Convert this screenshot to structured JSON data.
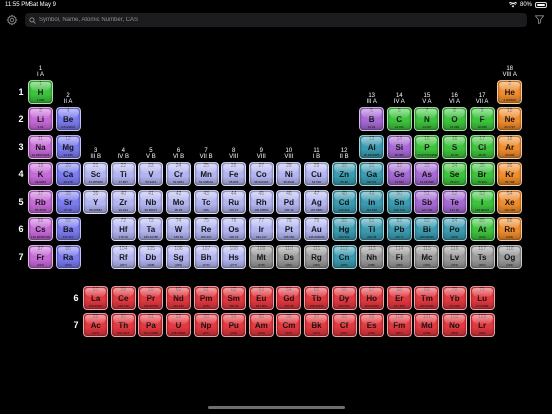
{
  "status": {
    "time": "11:55 PM",
    "date": "Sat May 9",
    "battery": "80%"
  },
  "search": {
    "placeholder": "Symbol, Name, Atomic Number, CAS"
  },
  "periods": [
    "1",
    "2",
    "3",
    "4",
    "5",
    "6",
    "7"
  ],
  "fperiods": [
    "6",
    "7"
  ],
  "groups": [
    {
      "col": 1,
      "n": "1",
      "r": "I A",
      "row": 1
    },
    {
      "col": 2,
      "n": "2",
      "r": "II A",
      "row": 2
    },
    {
      "col": 3,
      "n": "3",
      "r": "III B",
      "row": 4
    },
    {
      "col": 4,
      "n": "4",
      "r": "IV B",
      "row": 4
    },
    {
      "col": 5,
      "n": "5",
      "r": "V B",
      "row": 4
    },
    {
      "col": 6,
      "n": "6",
      "r": "VI B",
      "row": 4
    },
    {
      "col": 7,
      "n": "7",
      "r": "VII B",
      "row": 4
    },
    {
      "col": 8,
      "n": "8",
      "r": "VIII",
      "row": 4
    },
    {
      "col": 9,
      "n": "9",
      "r": "VIII",
      "row": 4
    },
    {
      "col": 10,
      "n": "10",
      "r": "VIII",
      "row": 4
    },
    {
      "col": 11,
      "n": "11",
      "r": "I B",
      "row": 4
    },
    {
      "col": 12,
      "n": "12",
      "r": "II B",
      "row": 4
    },
    {
      "col": 13,
      "n": "13",
      "r": "III A",
      "row": 2
    },
    {
      "col": 14,
      "n": "14",
      "r": "IV A",
      "row": 2
    },
    {
      "col": 15,
      "n": "15",
      "r": "V A",
      "row": 2
    },
    {
      "col": 16,
      "n": "16",
      "r": "VI A",
      "row": 2
    },
    {
      "col": 17,
      "n": "17",
      "r": "VII A",
      "row": 2
    },
    {
      "col": 18,
      "n": "18",
      "r": "VIII A",
      "row": 1
    }
  ],
  "colors": {
    "nonmetal": "#3ec33e",
    "alkali": "#c66ad8",
    "alkaline": "#7b7bf0",
    "transition": "#b3b5f0",
    "post": "#3b9bb0",
    "metalloid": "#a56ad3",
    "halogen": "#3ec33e",
    "noble": "#ef8c2d",
    "unknown": "#9a9a9a",
    "lanthanide": "#e2383f",
    "actinide": "#e2383f"
  },
  "elements": [
    {
      "n": 1,
      "s": "H",
      "m": "1.008",
      "p": 1,
      "g": 1,
      "c": "nonmetal"
    },
    {
      "n": 2,
      "s": "He",
      "m": "4.002602",
      "p": 1,
      "g": 18,
      "c": "noble"
    },
    {
      "n": 3,
      "s": "Li",
      "m": "6.94",
      "p": 2,
      "g": 1,
      "c": "alkali"
    },
    {
      "n": 4,
      "s": "Be",
      "m": "9.0121831",
      "p": 2,
      "g": 2,
      "c": "alkaline"
    },
    {
      "n": 5,
      "s": "B",
      "m": "10.81",
      "p": 2,
      "g": 13,
      "c": "metalloid"
    },
    {
      "n": 6,
      "s": "C",
      "m": "12.011",
      "p": 2,
      "g": 14,
      "c": "nonmetal"
    },
    {
      "n": 7,
      "s": "N",
      "m": "14.007",
      "p": 2,
      "g": 15,
      "c": "nonmetal"
    },
    {
      "n": 8,
      "s": "O",
      "m": "15.999",
      "p": 2,
      "g": 16,
      "c": "nonmetal"
    },
    {
      "n": 9,
      "s": "F",
      "m": "18.998",
      "p": 2,
      "g": 17,
      "c": "halogen"
    },
    {
      "n": 10,
      "s": "Ne",
      "m": "20.1797",
      "p": 2,
      "g": 18,
      "c": "noble"
    },
    {
      "n": 11,
      "s": "Na",
      "m": "22.98976928",
      "p": 3,
      "g": 1,
      "c": "alkali"
    },
    {
      "n": 12,
      "s": "Mg",
      "m": "24.305",
      "p": 3,
      "g": 2,
      "c": "alkaline"
    },
    {
      "n": 13,
      "s": "Al",
      "m": "26.9815385",
      "p": 3,
      "g": 13,
      "c": "post"
    },
    {
      "n": 14,
      "s": "Si",
      "m": "28.085",
      "p": 3,
      "g": 14,
      "c": "metalloid"
    },
    {
      "n": 15,
      "s": "P",
      "m": "30.973761998",
      "p": 3,
      "g": 15,
      "c": "nonmetal"
    },
    {
      "n": 16,
      "s": "S",
      "m": "32.06",
      "p": 3,
      "g": 16,
      "c": "nonmetal"
    },
    {
      "n": 17,
      "s": "Cl",
      "m": "35.45",
      "p": 3,
      "g": 17,
      "c": "halogen"
    },
    {
      "n": 18,
      "s": "Ar",
      "m": "39.948",
      "p": 3,
      "g": 18,
      "c": "noble"
    },
    {
      "n": 19,
      "s": "K",
      "m": "39.0983",
      "p": 4,
      "g": 1,
      "c": "alkali"
    },
    {
      "n": 20,
      "s": "Ca",
      "m": "40.078",
      "p": 4,
      "g": 2,
      "c": "alkaline"
    },
    {
      "n": 21,
      "s": "Sc",
      "m": "44.955908",
      "p": 4,
      "g": 3,
      "c": "transition"
    },
    {
      "n": 22,
      "s": "Ti",
      "m": "47.867",
      "p": 4,
      "g": 4,
      "c": "transition"
    },
    {
      "n": 23,
      "s": "V",
      "m": "50.9415",
      "p": 4,
      "g": 5,
      "c": "transition"
    },
    {
      "n": 24,
      "s": "Cr",
      "m": "51.9961",
      "p": 4,
      "g": 6,
      "c": "transition"
    },
    {
      "n": 25,
      "s": "Mn",
      "m": "54.938044",
      "p": 4,
      "g": 7,
      "c": "transition"
    },
    {
      "n": 26,
      "s": "Fe",
      "m": "55.845",
      "p": 4,
      "g": 8,
      "c": "transition"
    },
    {
      "n": 27,
      "s": "Co",
      "m": "58.933194",
      "p": 4,
      "g": 9,
      "c": "transition"
    },
    {
      "n": 28,
      "s": "Ni",
      "m": "58.6934",
      "p": 4,
      "g": 10,
      "c": "transition"
    },
    {
      "n": 29,
      "s": "Cu",
      "m": "63.546",
      "p": 4,
      "g": 11,
      "c": "transition"
    },
    {
      "n": 30,
      "s": "Zn",
      "m": "65.38",
      "p": 4,
      "g": 12,
      "c": "post"
    },
    {
      "n": 31,
      "s": "Ga",
      "m": "69.723",
      "p": 4,
      "g": 13,
      "c": "post"
    },
    {
      "n": 32,
      "s": "Ge",
      "m": "72.630",
      "p": 4,
      "g": 14,
      "c": "metalloid"
    },
    {
      "n": 33,
      "s": "As",
      "m": "74.921595",
      "p": 4,
      "g": 15,
      "c": "metalloid"
    },
    {
      "n": 34,
      "s": "Se",
      "m": "78.971",
      "p": 4,
      "g": 16,
      "c": "nonmetal"
    },
    {
      "n": 35,
      "s": "Br",
      "m": "79.904",
      "p": 4,
      "g": 17,
      "c": "halogen"
    },
    {
      "n": 36,
      "s": "Kr",
      "m": "83.798",
      "p": 4,
      "g": 18,
      "c": "noble"
    },
    {
      "n": 37,
      "s": "Rb",
      "m": "85.4678",
      "p": 5,
      "g": 1,
      "c": "alkali"
    },
    {
      "n": 38,
      "s": "Sr",
      "m": "87.62",
      "p": 5,
      "g": 2,
      "c": "alkaline"
    },
    {
      "n": 39,
      "s": "Y",
      "m": "88.90584",
      "p": 5,
      "g": 3,
      "c": "transition"
    },
    {
      "n": 40,
      "s": "Zr",
      "m": "91.224",
      "p": 5,
      "g": 4,
      "c": "transition"
    },
    {
      "n": 41,
      "s": "Nb",
      "m": "92.90637",
      "p": 5,
      "g": 5,
      "c": "transition"
    },
    {
      "n": 42,
      "s": "Mo",
      "m": "95.95",
      "p": 5,
      "g": 6,
      "c": "transition"
    },
    {
      "n": 43,
      "s": "Tc",
      "m": "(98)",
      "p": 5,
      "g": 7,
      "c": "transition"
    },
    {
      "n": 44,
      "s": "Ru",
      "m": "101.07",
      "p": 5,
      "g": 8,
      "c": "transition"
    },
    {
      "n": 45,
      "s": "Rh",
      "m": "102.90550",
      "p": 5,
      "g": 9,
      "c": "transition"
    },
    {
      "n": 46,
      "s": "Pd",
      "m": "106.42",
      "p": 5,
      "g": 10,
      "c": "transition"
    },
    {
      "n": 47,
      "s": "Ag",
      "m": "107.8682",
      "p": 5,
      "g": 11,
      "c": "transition"
    },
    {
      "n": 48,
      "s": "Cd",
      "m": "112.414",
      "p": 5,
      "g": 12,
      "c": "post"
    },
    {
      "n": 49,
      "s": "In",
      "m": "114.818",
      "p": 5,
      "g": 13,
      "c": "post"
    },
    {
      "n": 50,
      "s": "Sn",
      "m": "118.710",
      "p": 5,
      "g": 14,
      "c": "post"
    },
    {
      "n": 51,
      "s": "Sb",
      "m": "121.760",
      "p": 5,
      "g": 15,
      "c": "metalloid"
    },
    {
      "n": 52,
      "s": "Te",
      "m": "127.60",
      "p": 5,
      "g": 16,
      "c": "metalloid"
    },
    {
      "n": 53,
      "s": "I",
      "m": "126.90447",
      "p": 5,
      "g": 17,
      "c": "halogen"
    },
    {
      "n": 54,
      "s": "Xe",
      "m": "131.293",
      "p": 5,
      "g": 18,
      "c": "noble"
    },
    {
      "n": 55,
      "s": "Cs",
      "m": "132.90545196",
      "p": 6,
      "g": 1,
      "c": "alkali"
    },
    {
      "n": 56,
      "s": "Ba",
      "m": "137.327",
      "p": 6,
      "g": 2,
      "c": "alkaline"
    },
    {
      "n": 72,
      "s": "Hf",
      "m": "178.49",
      "p": 6,
      "g": 4,
      "c": "transition"
    },
    {
      "n": 73,
      "s": "Ta",
      "m": "180.94788",
      "p": 6,
      "g": 5,
      "c": "transition"
    },
    {
      "n": 74,
      "s": "W",
      "m": "183.84",
      "p": 6,
      "g": 6,
      "c": "transition"
    },
    {
      "n": 75,
      "s": "Re",
      "m": "186.207",
      "p": 6,
      "g": 7,
      "c": "transition"
    },
    {
      "n": 76,
      "s": "Os",
      "m": "190.23",
      "p": 6,
      "g": 8,
      "c": "transition"
    },
    {
      "n": 77,
      "s": "Ir",
      "m": "192.217",
      "p": 6,
      "g": 9,
      "c": "transition"
    },
    {
      "n": 78,
      "s": "Pt",
      "m": "195.084",
      "p": 6,
      "g": 10,
      "c": "transition"
    },
    {
      "n": 79,
      "s": "Au",
      "m": "196.966569",
      "p": 6,
      "g": 11,
      "c": "transition"
    },
    {
      "n": 80,
      "s": "Hg",
      "m": "200.592",
      "p": 6,
      "g": 12,
      "c": "post"
    },
    {
      "n": 81,
      "s": "Tl",
      "m": "204.38",
      "p": 6,
      "g": 13,
      "c": "post"
    },
    {
      "n": 82,
      "s": "Pb",
      "m": "207.2",
      "p": 6,
      "g": 14,
      "c": "post"
    },
    {
      "n": 83,
      "s": "Bi",
      "m": "208.98040",
      "p": 6,
      "g": 15,
      "c": "post"
    },
    {
      "n": 84,
      "s": "Po",
      "m": "(209)",
      "p": 6,
      "g": 16,
      "c": "post"
    },
    {
      "n": 85,
      "s": "At",
      "m": "(210)",
      "p": 6,
      "g": 17,
      "c": "halogen"
    },
    {
      "n": 86,
      "s": "Rn",
      "m": "(222)",
      "p": 6,
      "g": 18,
      "c": "noble"
    },
    {
      "n": 87,
      "s": "Fr",
      "m": "(223)",
      "p": 7,
      "g": 1,
      "c": "alkali"
    },
    {
      "n": 88,
      "s": "Ra",
      "m": "(226)",
      "p": 7,
      "g": 2,
      "c": "alkaline"
    },
    {
      "n": 104,
      "s": "Rf",
      "m": "(267)",
      "p": 7,
      "g": 4,
      "c": "transition"
    },
    {
      "n": 105,
      "s": "Db",
      "m": "(268)",
      "p": 7,
      "g": 5,
      "c": "transition"
    },
    {
      "n": 106,
      "s": "Sg",
      "m": "(269)",
      "p": 7,
      "g": 6,
      "c": "transition"
    },
    {
      "n": 107,
      "s": "Bh",
      "m": "(270)",
      "p": 7,
      "g": 7,
      "c": "transition"
    },
    {
      "n": 108,
      "s": "Hs",
      "m": "(277)",
      "p": 7,
      "g": 8,
      "c": "transition"
    },
    {
      "n": 109,
      "s": "Mt",
      "m": "(278)",
      "p": 7,
      "g": 9,
      "c": "unknown"
    },
    {
      "n": 110,
      "s": "Ds",
      "m": "(281)",
      "p": 7,
      "g": 10,
      "c": "unknown"
    },
    {
      "n": 111,
      "s": "Rg",
      "m": "(282)",
      "p": 7,
      "g": 11,
      "c": "unknown"
    },
    {
      "n": 112,
      "s": "Cn",
      "m": "(285)",
      "p": 7,
      "g": 12,
      "c": "post"
    },
    {
      "n": 113,
      "s": "Nh",
      "m": "(286)",
      "p": 7,
      "g": 13,
      "c": "unknown"
    },
    {
      "n": 114,
      "s": "Fl",
      "m": "(289)",
      "p": 7,
      "g": 14,
      "c": "unknown"
    },
    {
      "n": 115,
      "s": "Mc",
      "m": "(290)",
      "p": 7,
      "g": 15,
      "c": "unknown"
    },
    {
      "n": 116,
      "s": "Lv",
      "m": "(293)",
      "p": 7,
      "g": 16,
      "c": "unknown"
    },
    {
      "n": 117,
      "s": "Ts",
      "m": "(294)",
      "p": 7,
      "g": 17,
      "c": "unknown"
    },
    {
      "n": 118,
      "s": "Og",
      "m": "(294)",
      "p": 7,
      "g": 18,
      "c": "unknown"
    },
    {
      "n": 57,
      "s": "La",
      "m": "138.90547",
      "p": 9,
      "g": 3,
      "c": "lanthanide"
    },
    {
      "n": 58,
      "s": "Ce",
      "m": "140.116",
      "p": 9,
      "g": 4,
      "c": "lanthanide"
    },
    {
      "n": 59,
      "s": "Pr",
      "m": "140.90766",
      "p": 9,
      "g": 5,
      "c": "lanthanide"
    },
    {
      "n": 60,
      "s": "Nd",
      "m": "144.242",
      "p": 9,
      "g": 6,
      "c": "lanthanide"
    },
    {
      "n": 61,
      "s": "Pm",
      "m": "(145)",
      "p": 9,
      "g": 7,
      "c": "lanthanide"
    },
    {
      "n": 62,
      "s": "Sm",
      "m": "150.36",
      "p": 9,
      "g": 8,
      "c": "lanthanide"
    },
    {
      "n": 63,
      "s": "Eu",
      "m": "151.964",
      "p": 9,
      "g": 9,
      "c": "lanthanide"
    },
    {
      "n": 64,
      "s": "Gd",
      "m": "157.25",
      "p": 9,
      "g": 10,
      "c": "lanthanide"
    },
    {
      "n": 65,
      "s": "Tb",
      "m": "158.92535",
      "p": 9,
      "g": 11,
      "c": "lanthanide"
    },
    {
      "n": 66,
      "s": "Dy",
      "m": "162.500",
      "p": 9,
      "g": 12,
      "c": "lanthanide"
    },
    {
      "n": 67,
      "s": "Ho",
      "m": "164.93033",
      "p": 9,
      "g": 13,
      "c": "lanthanide"
    },
    {
      "n": 68,
      "s": "Er",
      "m": "167.259",
      "p": 9,
      "g": 14,
      "c": "lanthanide"
    },
    {
      "n": 69,
      "s": "Tm",
      "m": "168.93422",
      "p": 9,
      "g": 15,
      "c": "lanthanide"
    },
    {
      "n": 70,
      "s": "Yb",
      "m": "173.045",
      "p": 9,
      "g": 16,
      "c": "lanthanide"
    },
    {
      "n": 71,
      "s": "Lu",
      "m": "174.9668",
      "p": 9,
      "g": 17,
      "c": "lanthanide"
    },
    {
      "n": 89,
      "s": "Ac",
      "m": "(227)",
      "p": 10,
      "g": 3,
      "c": "actinide"
    },
    {
      "n": 90,
      "s": "Th",
      "m": "232.0377",
      "p": 10,
      "g": 4,
      "c": "actinide"
    },
    {
      "n": 91,
      "s": "Pa",
      "m": "231.03588",
      "p": 10,
      "g": 5,
      "c": "actinide"
    },
    {
      "n": 92,
      "s": "U",
      "m": "238.02891",
      "p": 10,
      "g": 6,
      "c": "actinide"
    },
    {
      "n": 93,
      "s": "Np",
      "m": "(237)",
      "p": 10,
      "g": 7,
      "c": "actinide"
    },
    {
      "n": 94,
      "s": "Pu",
      "m": "(244)",
      "p": 10,
      "g": 8,
      "c": "actinide"
    },
    {
      "n": 95,
      "s": "Am",
      "m": "(243)",
      "p": 10,
      "g": 9,
      "c": "actinide"
    },
    {
      "n": 96,
      "s": "Cm",
      "m": "(247)",
      "p": 10,
      "g": 10,
      "c": "actinide"
    },
    {
      "n": 97,
      "s": "Bk",
      "m": "(247)",
      "p": 10,
      "g": 11,
      "c": "actinide"
    },
    {
      "n": 98,
      "s": "Cf",
      "m": "(251)",
      "p": 10,
      "g": 12,
      "c": "actinide"
    },
    {
      "n": 99,
      "s": "Es",
      "m": "(252)",
      "p": 10,
      "g": 13,
      "c": "actinide"
    },
    {
      "n": 100,
      "s": "Fm",
      "m": "(257)",
      "p": 10,
      "g": 14,
      "c": "actinide"
    },
    {
      "n": 101,
      "s": "Md",
      "m": "(258)",
      "p": 10,
      "g": 15,
      "c": "actinide"
    },
    {
      "n": 102,
      "s": "No",
      "m": "(259)",
      "p": 10,
      "g": 16,
      "c": "actinide"
    },
    {
      "n": 103,
      "s": "Lr",
      "m": "(266)",
      "p": 10,
      "g": 17,
      "c": "actinide"
    }
  ]
}
